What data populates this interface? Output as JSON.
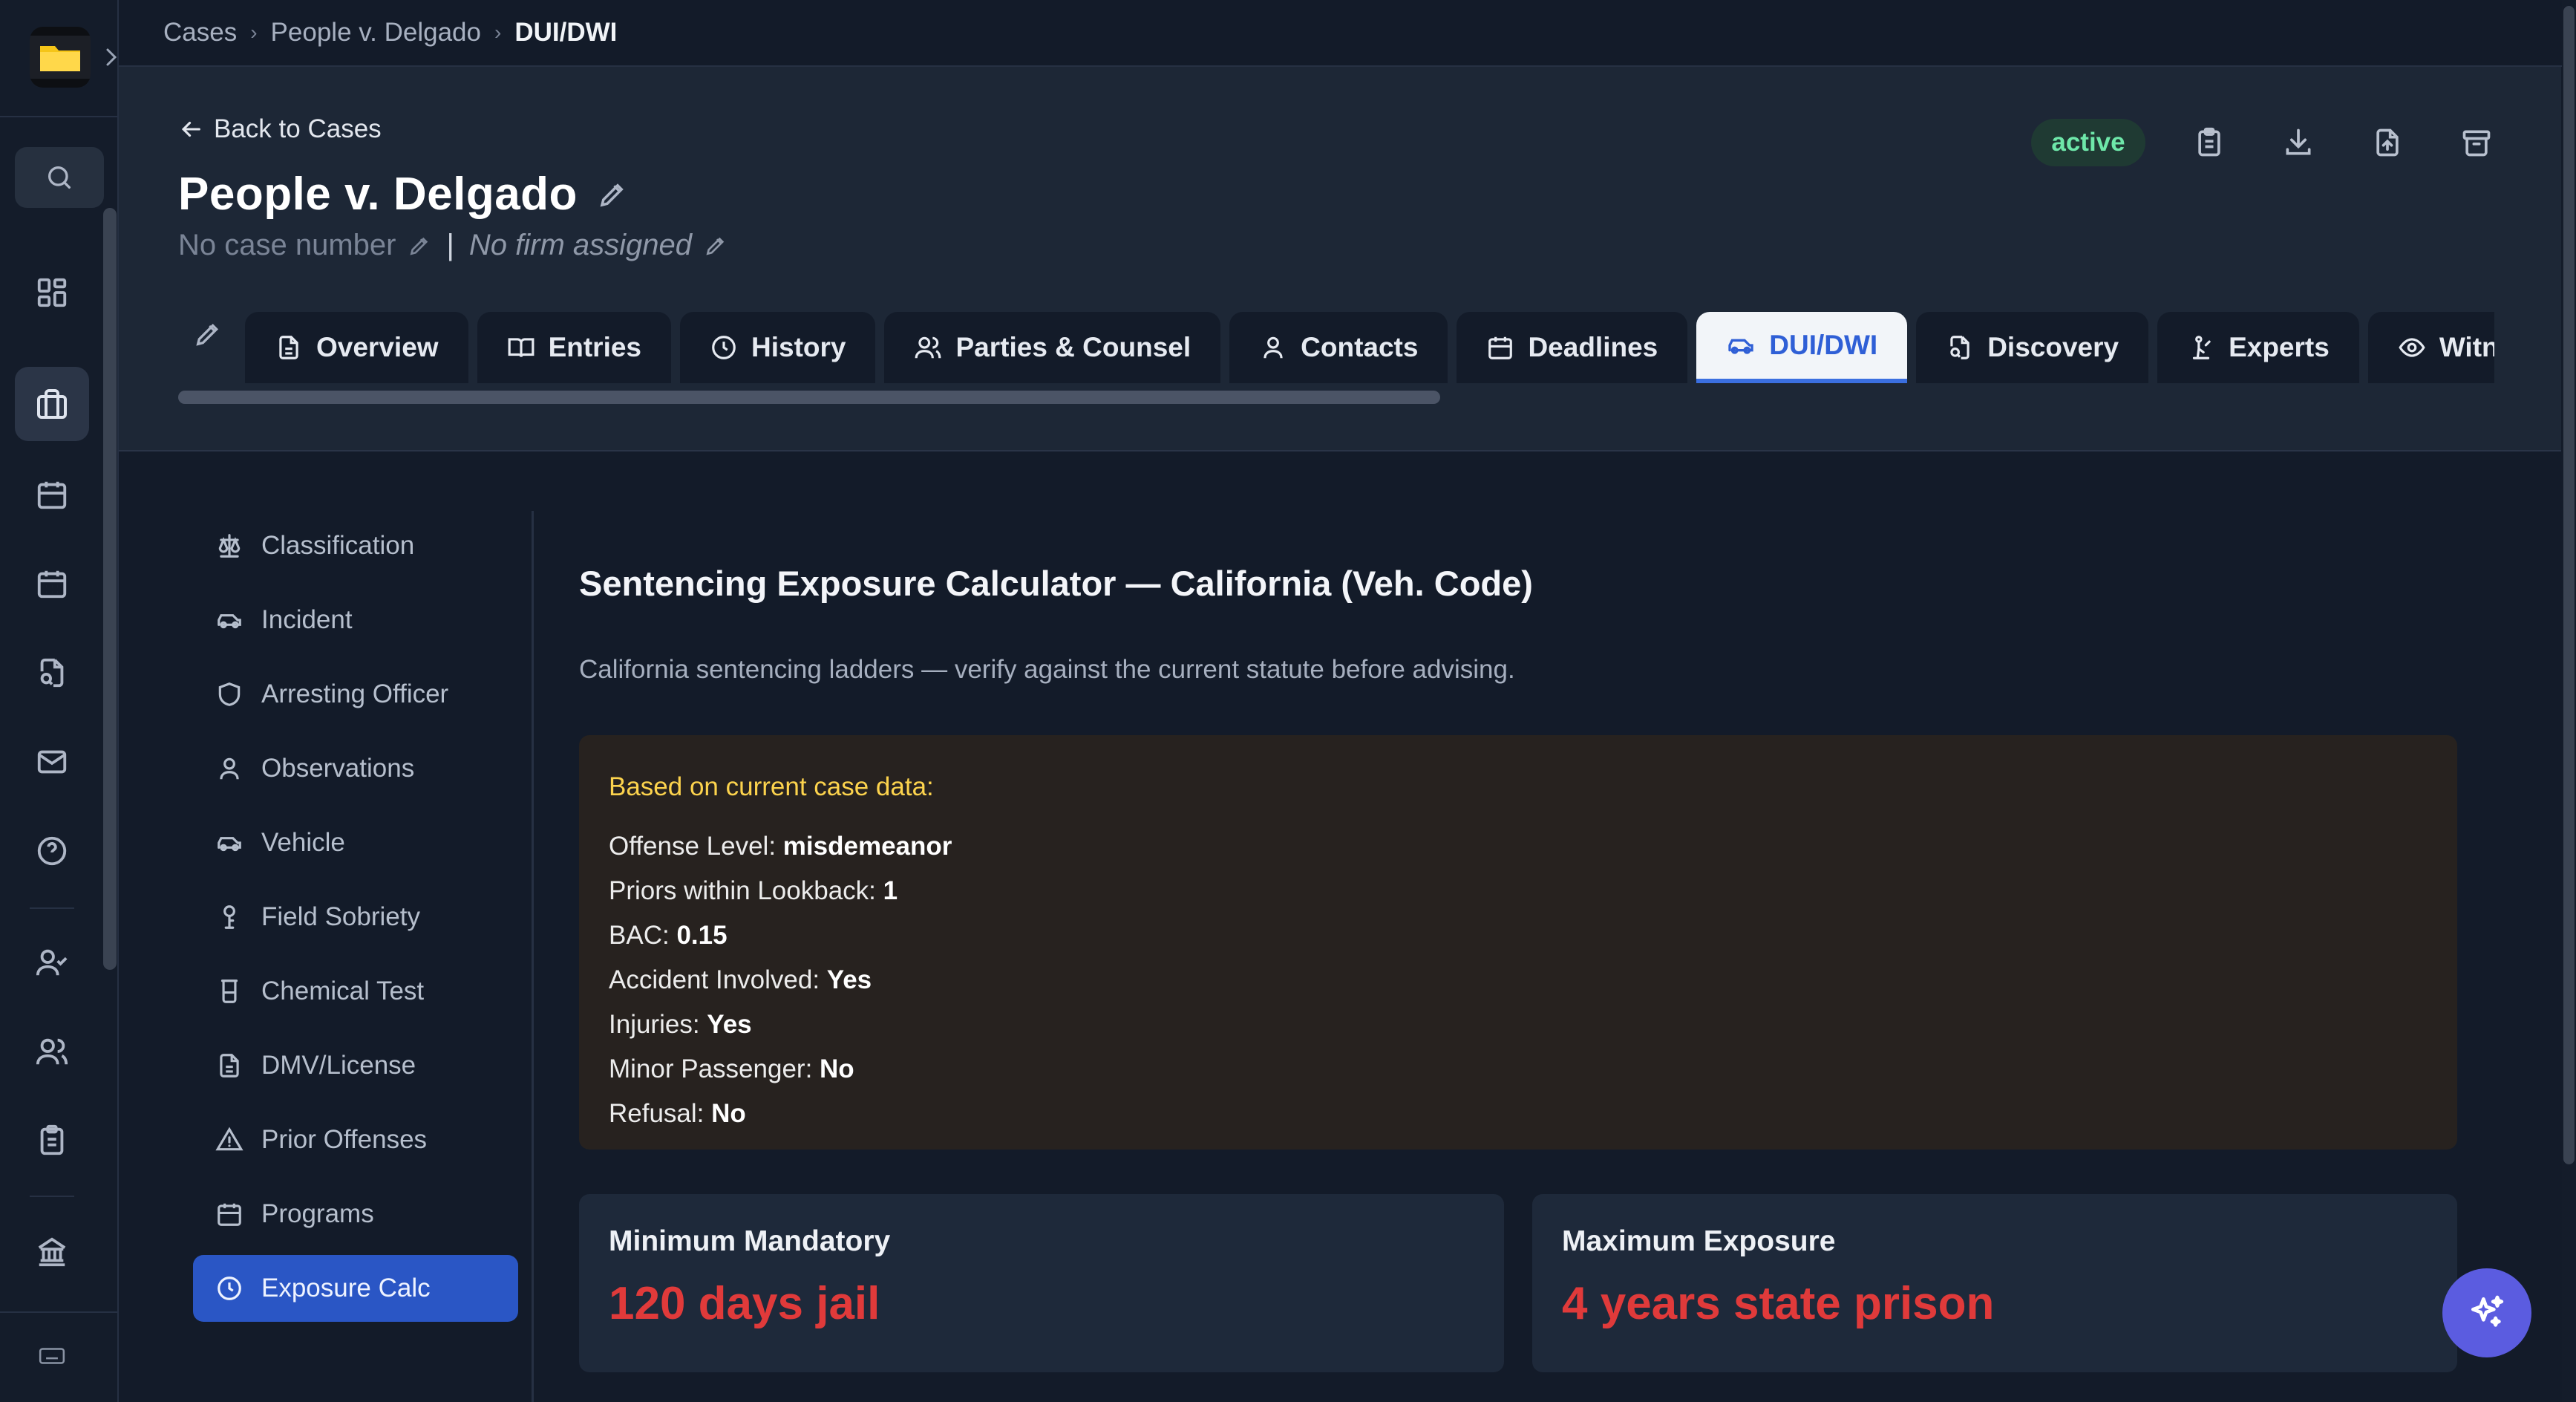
{
  "breadcrumb": [
    "Cases",
    "People v. Delgado",
    "DUI/DWI"
  ],
  "rail": {
    "icons": [
      "folder-logo",
      "search-icon",
      "dashboard-icon",
      "briefcase-icon",
      "calendar-icon",
      "calendar-grid-icon",
      "document-search-icon",
      "mail-icon",
      "help-icon",
      "user-check-icon",
      "users-icon",
      "clipboard-icon",
      "courthouse-icon",
      "keyboard-icon"
    ],
    "active": "briefcase-icon"
  },
  "header": {
    "back_label": "Back to Cases",
    "case_title": "People v. Delgado",
    "case_number": "No case number",
    "firm": "No firm assigned",
    "separator": "|",
    "status": "active"
  },
  "tabs": [
    {
      "label": "Overview",
      "icon": "document-icon"
    },
    {
      "label": "Entries",
      "icon": "book-icon"
    },
    {
      "label": "History",
      "icon": "clock-icon"
    },
    {
      "label": "Parties & Counsel",
      "icon": "users-icon"
    },
    {
      "label": "Contacts",
      "icon": "user-icon"
    },
    {
      "label": "Deadlines",
      "icon": "calendar-icon"
    },
    {
      "label": "DUI/DWI",
      "icon": "car-icon",
      "active": true
    },
    {
      "label": "Discovery",
      "icon": "file-search-icon"
    },
    {
      "label": "Experts",
      "icon": "expert-icon"
    },
    {
      "label": "Witnesses",
      "icon": "eye-icon"
    }
  ],
  "subnav": [
    {
      "label": "Classification",
      "icon": "scale-icon"
    },
    {
      "label": "Incident",
      "icon": "car-icon"
    },
    {
      "label": "Arresting Officer",
      "icon": "shield-icon"
    },
    {
      "label": "Observations",
      "icon": "user-icon"
    },
    {
      "label": "Vehicle",
      "icon": "car-icon"
    },
    {
      "label": "Field Sobriety",
      "icon": "test-icon"
    },
    {
      "label": "Chemical Test",
      "icon": "beaker-icon"
    },
    {
      "label": "DMV/License",
      "icon": "document-icon"
    },
    {
      "label": "Prior Offenses",
      "icon": "warning-icon"
    },
    {
      "label": "Programs",
      "icon": "calendar-icon"
    },
    {
      "label": "Exposure Calc",
      "icon": "clock-icon",
      "active": true
    }
  ],
  "calculator": {
    "title": "Sentencing Exposure Calculator — California (Veh. Code)",
    "note": "California sentencing ladders — verify against the current statute before advising.",
    "case_data_caption": "Based on current case data:",
    "case_data": [
      {
        "label": "Offense Level:",
        "value": "misdemeanor"
      },
      {
        "label": "Priors within Lookback:",
        "value": "1"
      },
      {
        "label": "BAC:",
        "value": "0.15"
      },
      {
        "label": "Accident Involved:",
        "value": "Yes"
      },
      {
        "label": "Injuries:",
        "value": "Yes"
      },
      {
        "label": "Minor Passenger:",
        "value": "No"
      },
      {
        "label": "Refusal:",
        "value": "No"
      }
    ],
    "minimum": {
      "label": "Minimum Mandatory",
      "value": "120 days jail"
    },
    "maximum": {
      "label": "Maximum Exposure",
      "value": "4 years state prison"
    }
  },
  "colors": {
    "accent": "#2a56c5",
    "danger": "#e03a3a",
    "status": "#6ee7a9",
    "note_caption": "#fcd34d"
  }
}
